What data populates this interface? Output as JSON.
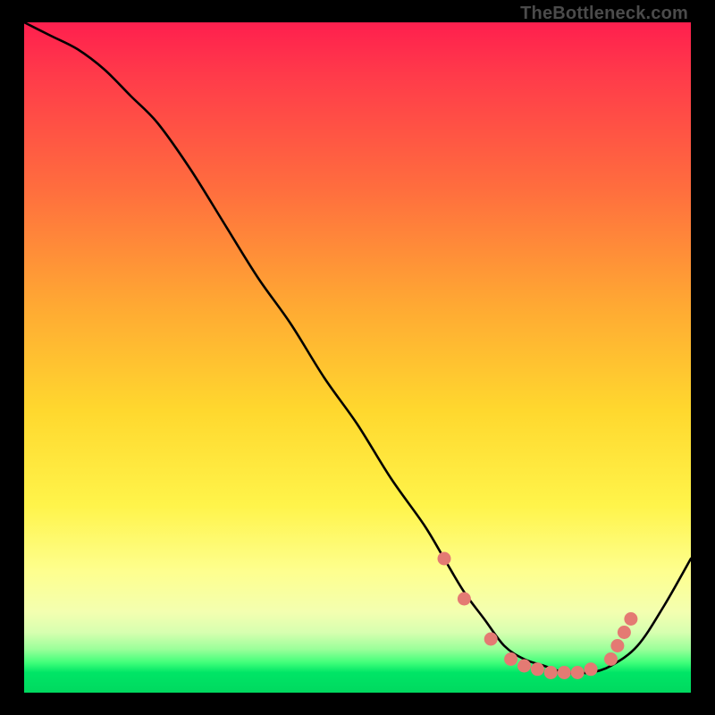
{
  "watermark": "TheBottleneck.com",
  "colors": {
    "frame": "#000000",
    "curve": "#000000",
    "dot": "#e47a73",
    "gradient_top": "#ff1f4e",
    "gradient_bottom": "#00d95f"
  },
  "chart_data": {
    "type": "line",
    "title": "",
    "xlabel": "",
    "ylabel": "",
    "xlim": [
      0,
      100
    ],
    "ylim": [
      0,
      100
    ],
    "x": [
      0,
      4,
      8,
      12,
      16,
      20,
      25,
      30,
      35,
      40,
      45,
      50,
      55,
      60,
      63,
      66,
      69,
      72,
      75,
      78,
      81,
      83,
      85,
      88,
      92,
      96,
      100
    ],
    "y": [
      100,
      98,
      96,
      93,
      89,
      85,
      78,
      70,
      62,
      55,
      47,
      40,
      32,
      25,
      20,
      15,
      11,
      7,
      5,
      4,
      3,
      3,
      3,
      4,
      7,
      13,
      20
    ],
    "markers": {
      "x": [
        63,
        66,
        70,
        73,
        75,
        77,
        79,
        81,
        83,
        85,
        88,
        89,
        90,
        91
      ],
      "y": [
        20,
        14,
        8,
        5,
        4,
        3.5,
        3,
        3,
        3,
        3.5,
        5,
        7,
        9,
        11
      ]
    },
    "annotations": []
  }
}
